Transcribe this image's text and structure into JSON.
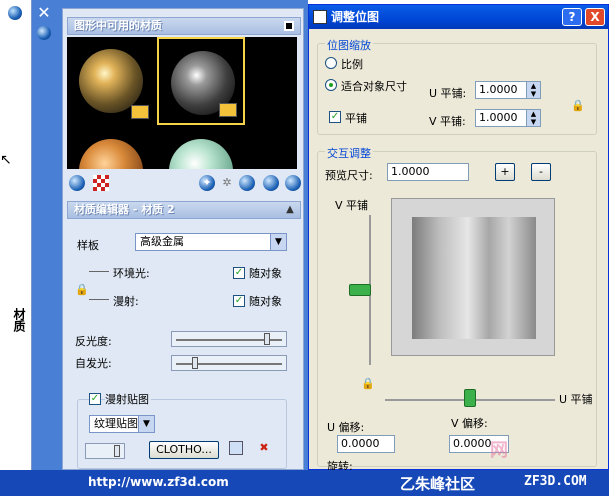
{
  "strip": {
    "title": "材质"
  },
  "palette": {
    "section1_title": "图形中可用的材质",
    "section2_title": "材质编辑器 - 材质 2",
    "template_label": "样板",
    "template_value": "高级金属",
    "ambient_label": "环境光:",
    "diffuse_label": "漫射:",
    "by_object_label": "随对象",
    "reflectivity_label": "反光度:",
    "self_illum_label": "自发光:",
    "reflectivity_value": 0.85,
    "self_illum_value": 0.15,
    "diffuse_map_label": "漫射贴图",
    "map_type_value": "纹理贴图",
    "map_file_value": "CLOTHO..."
  },
  "dialog": {
    "title": "调整位图",
    "help_label": "?",
    "close_label": "X",
    "scale_group": "位图缩放",
    "ratio_label": "比例",
    "fit_label": "适合对象尺寸",
    "u_tile_label": "U 平铺:",
    "v_tile_label": "V 平铺:",
    "u_tile_value": "1.0000",
    "v_tile_value": "1.0000",
    "tile_label": "平铺",
    "interactive_group": "交互调整",
    "preview_size_label": "预览尺寸:",
    "preview_size_value": "1.0000",
    "plus_label": "+",
    "minus_label": "-",
    "v_tile_axis_label": "V 平铺",
    "u_tile_axis_label": "U 平铺",
    "u_offset_label": "U 偏移:",
    "v_offset_label": "V 偏移:",
    "u_offset_value": "0.0000",
    "v_offset_value": "0.0000",
    "rotate_label": "旋转:",
    "v_slider_value": 0.5,
    "u_slider_value": 0.5
  },
  "footer": {
    "url": "http://www.zf3d.com",
    "brand": "乙朱峰社区",
    "site": "ZF3D.COM",
    "watermark": "网"
  },
  "colors": {
    "palette_blue": "#4a7fd6",
    "title_bar": "#0a5ee8",
    "dialog_bg": "#ece9d8",
    "footer_blue": "#1648b7",
    "legend_blue": "#0046d5"
  }
}
